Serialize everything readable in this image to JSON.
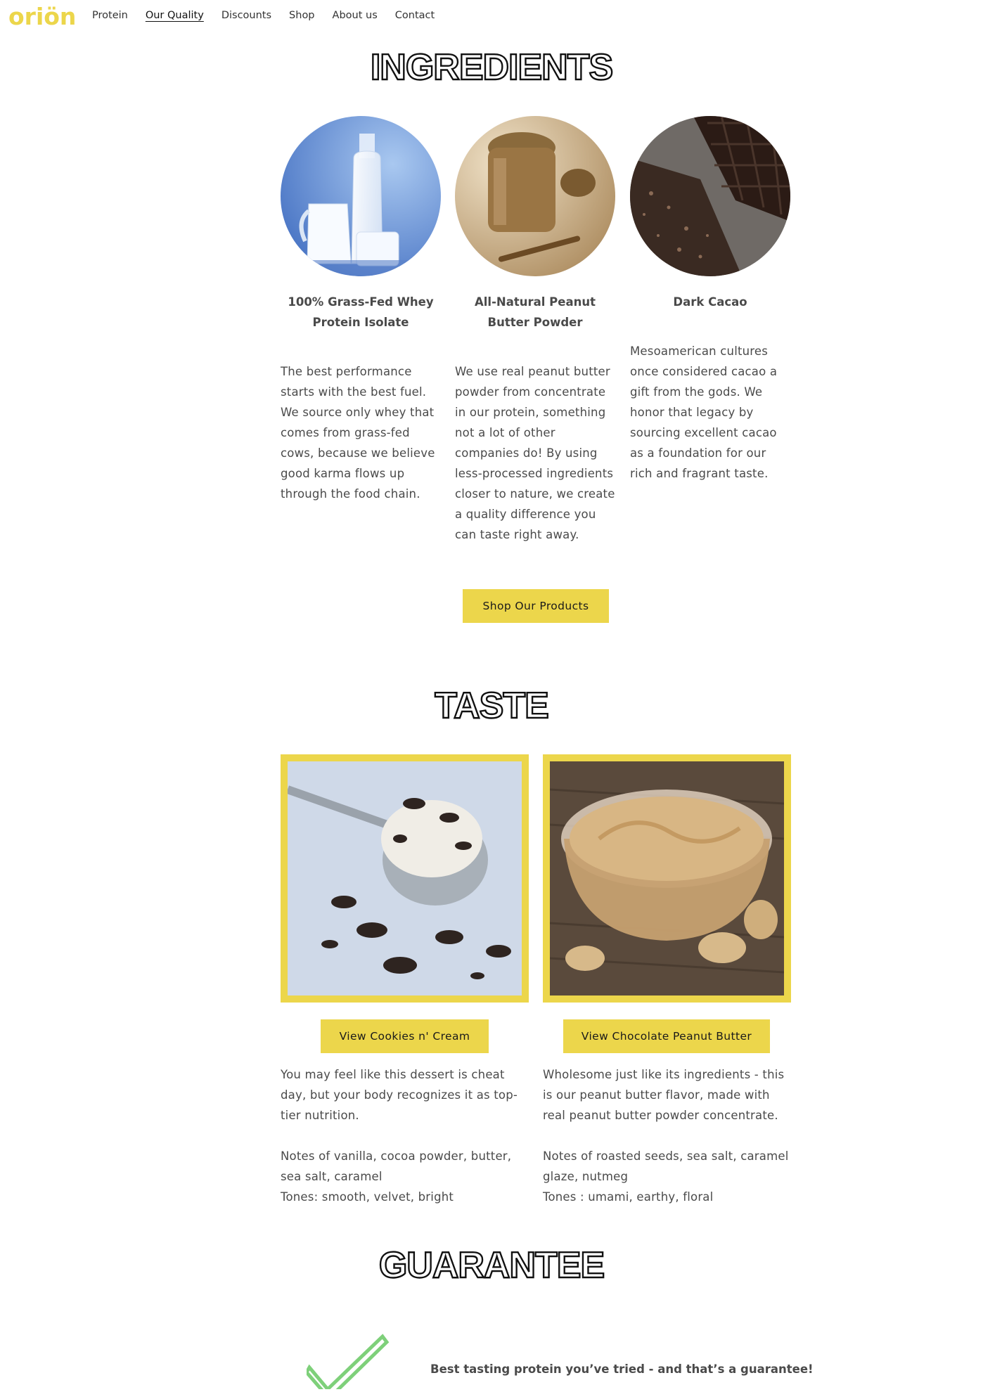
{
  "brand": {
    "logo": "oriön",
    "accent": "#ecd64b"
  },
  "nav": {
    "items": [
      {
        "label": "Protein"
      },
      {
        "label": "Our Quality",
        "active": true
      },
      {
        "label": "Discounts"
      },
      {
        "label": "Shop"
      },
      {
        "label": "About us"
      },
      {
        "label": "Contact"
      }
    ]
  },
  "ingredients": {
    "heading": "INGREDIENTS",
    "items": [
      {
        "title": "100% Grass-Fed Whey Protein Isolate",
        "text": "The best performance starts with the best fuel. We source only whey that comes from grass-fed cows, because we believe good karma flows up through the food chain."
      },
      {
        "title": "All-Natural Peanut Butter Powder",
        "text": "We use real peanut butter powder from concentrate in our protein, something not a lot of other companies do! By using less-processed ingredients closer to nature, we create a quality difference you can taste right away."
      },
      {
        "title": "Dark Cacao",
        "text": "Mesoamerican cultures once considered cacao a gift from the gods. We honor that legacy by sourcing excellent cacao as a foundation for our rich and fragrant taste."
      }
    ],
    "cta": "Shop Our Products"
  },
  "taste": {
    "heading": "TASTE",
    "items": [
      {
        "button": "View Cookies n' Cream",
        "description": "You may feel like this dessert is cheat day, but your body recognizes it as top-tier nutrition.",
        "notes": "Notes of vanilla, cocoa powder, butter, sea salt, caramel",
        "tones": "Tones: smooth, velvet, bright"
      },
      {
        "button": "View Chocolate Peanut Butter",
        "description": "Wholesome just like its ingredients - this is our peanut butter flavor, made with real peanut butter powder concentrate.",
        "notes": "Notes of roasted seeds, sea salt, caramel glaze, nutmeg",
        "tones": "Tones : umami, earthy, floral"
      }
    ]
  },
  "guarantee": {
    "heading": "GUARANTEE",
    "icon": "checkmark-icon",
    "text": "Best tasting protein you’ve tried - and that’s a guarantee!"
  }
}
